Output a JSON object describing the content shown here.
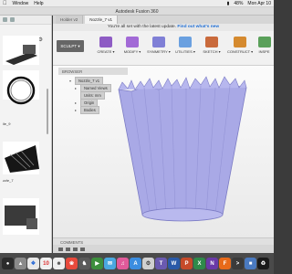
{
  "menubar": {
    "app": "Window",
    "items": [
      "Help"
    ],
    "battery": "48%",
    "clock": "Mon Apr 10"
  },
  "window": {
    "title": "Autodesk Fusion 360"
  },
  "tabs": [
    {
      "label": "Holder v2"
    },
    {
      "label": "Nozzle_7 v1"
    }
  ],
  "notice": {
    "text": "You're all set with the latest update.",
    "link": "Find out what's new"
  },
  "toolbar": {
    "workspace": "SCULPT ▾",
    "tools": [
      "CREATE ▾",
      "MODIFY ▾",
      "SYMMETRY ▾",
      "UTILITIES ▾",
      "SKETCH ▾",
      "CONSTRUCT ▾",
      "INSPE"
    ]
  },
  "browser": {
    "title": "BROWSER",
    "component": "Nozzle_7 v1",
    "rows": [
      "Named Views",
      "Units: mm",
      "Origin",
      "Bodies"
    ]
  },
  "left_panel": {
    "items": [
      "ile_9",
      "zzle_7"
    ]
  },
  "footer": {
    "comments": "COMMENTS"
  },
  "colors": {
    "accent": "#1f6fd6",
    "model_fill": "#a9a9e6",
    "model_edge": "#7b7bc4"
  }
}
